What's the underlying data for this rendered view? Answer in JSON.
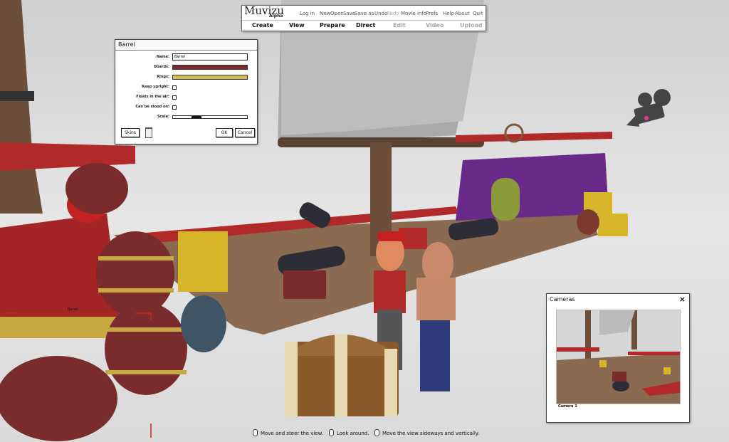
{
  "menu": {
    "logo": "Muvizu",
    "logo_sub": "Alpha",
    "top_items": [
      "Log in",
      "New",
      "Open",
      "Save",
      "Save as",
      "Undo",
      "Redo",
      "Movie info",
      "Prefs",
      "Help",
      "About",
      "Quit"
    ],
    "tabs": [
      "Create",
      "View",
      "Prepare",
      "Direct",
      "Edit",
      "Video",
      "Upload"
    ]
  },
  "barrel_panel": {
    "title": "Barrel",
    "name_label": "Name:",
    "name_value": "Barrel",
    "boards_label": "Boards:",
    "boards_color": "#7a2b2b",
    "rings_label": "Rings:",
    "rings_color": "#d4bc5a",
    "keep_upright_label": "Keep upright:",
    "floats_label": "Floats in the air:",
    "stood_on_label": "Can be stood on:",
    "scale_label": "Scale:",
    "skins_button": "Skins",
    "ok_button": "OK",
    "cancel_button": "Cancel"
  },
  "cameras_panel": {
    "title": "Cameras",
    "close": "×",
    "camera_label": "Camera 1"
  },
  "scene": {
    "barrel_tag": "Barrel"
  },
  "hints": {
    "move": "Move and steer the view.",
    "look": "Look around.",
    "sideways": "Move the view sideways and vertically."
  }
}
